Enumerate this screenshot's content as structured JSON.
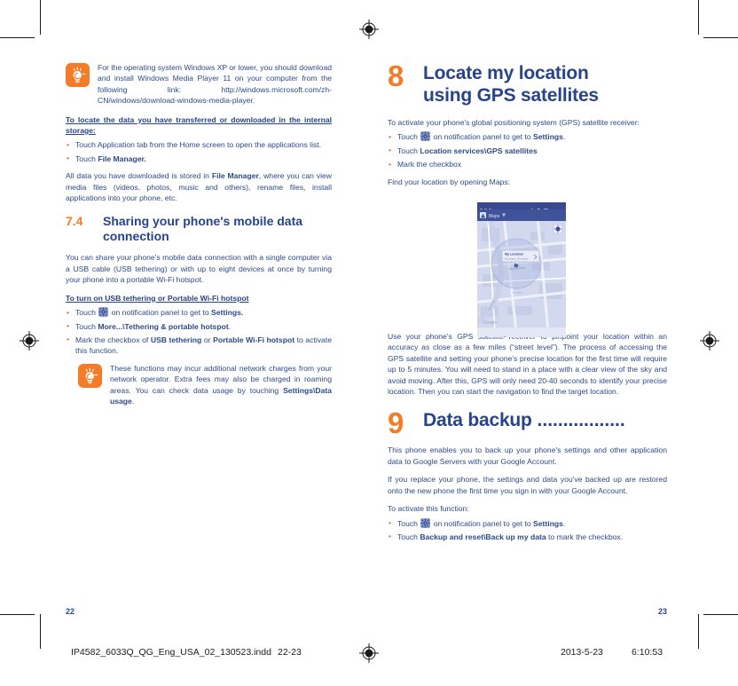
{
  "document": {
    "left_page_number": "22",
    "right_page_number": "23"
  },
  "left_column": {
    "tip_1": {
      "icon": "lightbulb-tip-icon",
      "text": "For the operating system Windows XP or lower, you should download and install Windows Media Player 11 on your computer from the following link: http://windows.microsoft.com/zh-CN/windows/download-windows-media-player."
    },
    "heading_locate_data": "To locate the data you have transferred or downloaded in the internal storage:",
    "bullets_locate": [
      "Touch Application tab from the Home screen to open the applications list.",
      "Touch File Manager."
    ],
    "bullets_locate_bold": [
      "",
      "File Manager."
    ],
    "paragraph_all_data": "All data you have downloaded is stored in File Manager, where you can view media files (videos, photos, music and others), rename files, install applications into your phone, etc.",
    "paragraph_all_data_bold": "File Manager",
    "section_7_4": {
      "number": "7.4",
      "title": "Sharing your phone's mobile data connection"
    },
    "paragraph_share": "You can share your phone's mobile data connection with a single computer via a USB cable (USB tethering) or with up to eight devices at once by turning your phone into a portable Wi-Fi hotspot.",
    "heading_turn_on": "To turn on USB tethering or Portable Wi-Fi hotspot",
    "bullet_touch_settings_pre": "Touch",
    "bullet_touch_settings_mid": "on notification panel to get to",
    "bullet_touch_settings_bold": "Settings.",
    "bullet_more_pre": "Touch",
    "bullet_more_bold": "More...\\Tethering & portable hotspot",
    "bullet_more_post": ".",
    "bullet_mark_pre": "Mark the checkbox of",
    "bullet_mark_bold_1": "USB tethering",
    "bullet_mark_mid": "or",
    "bullet_mark_bold_2": "Portable Wi-Fi hotspot",
    "bullet_mark_post": "to activate this function.",
    "tip_2": {
      "icon": "lightbulb-tip-icon",
      "text_pre": "These functions may incur additional network charges from your network operator. Extra fees may also be charged in roaming areas. You can check data usage by touching",
      "text_bold": "Settings\\Data usage",
      "text_post": "."
    }
  },
  "right_column": {
    "section_8": {
      "number": "8",
      "title_line_1": "Locate my location",
      "title_line_2": "using GPS satellites"
    },
    "paragraph_activate_gps": "To activate your phone's global positioning system (GPS) satellite receiver:",
    "bullet_gps_touch_pre": "Touch",
    "bullet_gps_touch_mid": "on notification panel to get to",
    "bullet_gps_touch_bold": "Settings",
    "bullet_gps_touch_post": ".",
    "bullet_location_services_pre": "Touch",
    "bullet_location_services_bold": "Location services\\GPS satellites",
    "bullet_mark_checkbox": "Mark the checkbox",
    "paragraph_find_location": "Find your location by opening Maps:",
    "screenshot": {
      "app_name": "Maps",
      "status_time": "15:19",
      "callout_title": "My Location",
      "callout_subtitle": "Accuracy: 10 metres",
      "street_label": "Wulong Road",
      "watermark": "Google",
      "nav_icons": [
        "search-icon",
        "directions-icon",
        "layers-icon",
        "places-icon",
        "menu-icon"
      ]
    },
    "paragraph_gps_use": "Use your phone's GPS satellite receiver to pinpoint your location within an accuracy as close as a few miles (“street level”). The process of accessing the GPS satellite and setting your phone's precise location for the first time will require up to 5 minutes. You will need to stand in a place with a clear view of the sky and avoid moving. After this, GPS will only need 20-40 seconds to identify your precise location. Then you can start the navigation to find the target location.",
    "section_9": {
      "number": "9",
      "title": "Data backup",
      "dots": " ................."
    },
    "paragraph_backup_1": "This phone enables you to back up your phone's settings and other application data to Google Servers with your Google Account.",
    "paragraph_backup_2": "If you replace your phone, the settings and data you've backed up are restored onto the new phone the first time you sign in with your Google Account.",
    "paragraph_activate_function": "To activate this function:",
    "bullet_backup_touch_pre": "Touch",
    "bullet_backup_touch_mid": "on notification panel to get to",
    "bullet_backup_touch_bold": "Settings",
    "bullet_backup_touch_post": ".",
    "bullet_backup_reset_pre": "Touch",
    "bullet_backup_reset_bold": "Backup and reset\\Back up my data",
    "bullet_backup_reset_post": "to mark the checkbox."
  },
  "footer": {
    "filename": "IP4582_6033Q_QG_Eng_USA_02_130523.indd",
    "page_range": "22-23",
    "date": "2013-5-23",
    "time": "6:10:53"
  },
  "colors": {
    "heading_blue": "#27438a",
    "body_blue": "#2b4a8b",
    "accent_orange": "#f47b27",
    "bullet_orange": "#e8622c",
    "tip_icon_bg": "#f47b27",
    "gear_icon_bg": "#8f9ed4",
    "map_blue": "#cfd7ed",
    "actionbar_blue": "#40529a"
  }
}
